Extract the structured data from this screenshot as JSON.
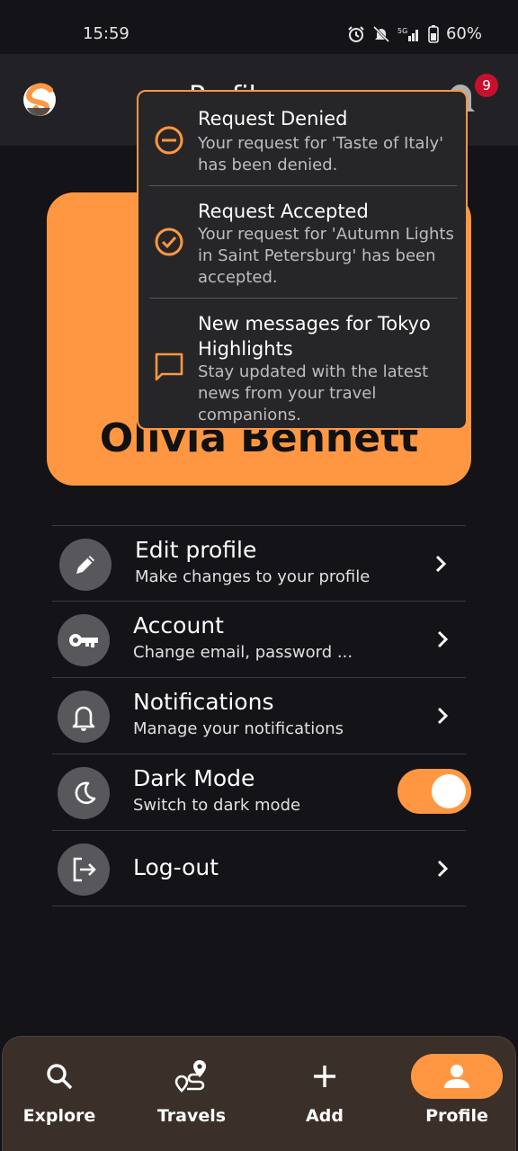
{
  "status": {
    "time": "15:59",
    "battery": "60%"
  },
  "header": {
    "title": "Profile",
    "notification_count": "9"
  },
  "profile": {
    "name": "Olivia Bennett"
  },
  "notifications": [
    {
      "title": "Request Denied",
      "text": "Your request for 'Taste of Italy' has been denied.",
      "icon": "minus-circle-icon"
    },
    {
      "title": "Request Accepted",
      "text": "Your request for 'Autumn Lights in Saint Petersburg' has been accepted.",
      "icon": "check-circle-icon"
    },
    {
      "title": "New messages for Tokyo Highlights",
      "text": "Stay updated with the latest news from your travel companions.",
      "icon": "chat-icon"
    }
  ],
  "menu": [
    {
      "title": "Edit profile",
      "subtitle": "Make changes to your profile",
      "icon": "pencil-icon"
    },
    {
      "title": "Account",
      "subtitle": "Change email, password ...",
      "icon": "key-icon"
    },
    {
      "title": "Notifications",
      "subtitle": "Manage your notifications",
      "icon": "bell-icon"
    },
    {
      "title": "Dark Mode",
      "subtitle": "Switch to dark mode",
      "icon": "moon-icon",
      "toggle_on": true
    },
    {
      "title": "Log-out",
      "subtitle": "",
      "icon": "logout-icon"
    }
  ],
  "nav": [
    {
      "label": "Explore",
      "icon": "search-icon"
    },
    {
      "label": "Travels",
      "icon": "route-icon"
    },
    {
      "label": "Add",
      "icon": "plus-icon"
    },
    {
      "label": "Profile",
      "icon": "person-icon",
      "active": true
    }
  ],
  "colors": {
    "accent": "#ff9742",
    "background": "#131318",
    "badge": "#c8102e"
  }
}
